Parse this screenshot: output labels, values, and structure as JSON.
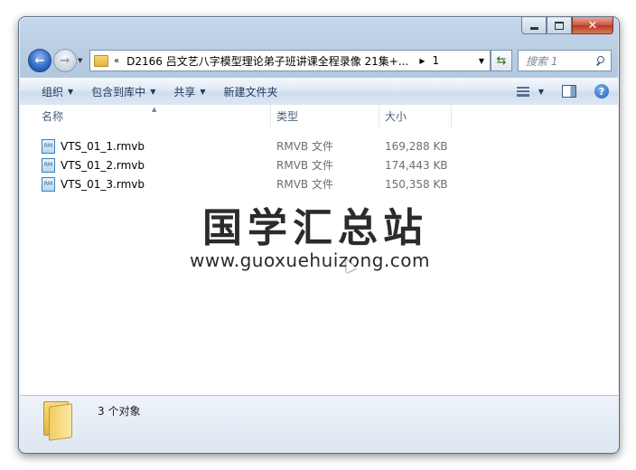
{
  "window": {
    "nav_back_icon": "back-arrow-icon",
    "nav_forward_icon": "forward-arrow-icon"
  },
  "address": {
    "overflow": "«",
    "path": "D2166 吕文艺八字模型理论弟子班讲课全程录像 21集+...",
    "current": "1"
  },
  "search": {
    "placeholder": "搜索 1"
  },
  "toolbar": {
    "organize": "组织",
    "include_library": "包含到库中",
    "share": "共享",
    "new_folder": "新建文件夹"
  },
  "columns": {
    "name": "名称",
    "type": "类型",
    "size": "大小"
  },
  "files": [
    {
      "name": "VTS_01_1.rmvb",
      "type": "RMVB 文件",
      "size": "169,288 KB"
    },
    {
      "name": "VTS_01_2.rmvb",
      "type": "RMVB 文件",
      "size": "174,443 KB"
    },
    {
      "name": "VTS_01_3.rmvb",
      "type": "RMVB 文件",
      "size": "150,358 KB"
    }
  ],
  "file_icon_label": "RM",
  "watermark": {
    "logo": "国学汇总站",
    "url": "www.guoxuehuizong.com"
  },
  "details": {
    "count": "3 个对象"
  }
}
